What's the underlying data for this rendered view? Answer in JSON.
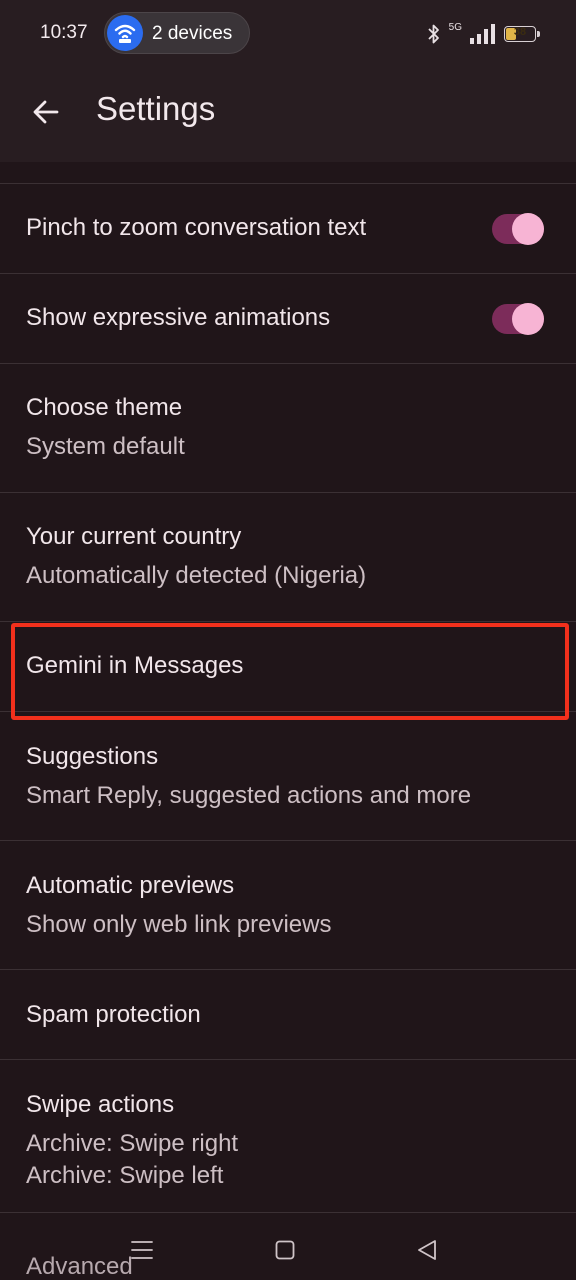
{
  "status_bar": {
    "time": "10:37",
    "hotspot_label": "2 devices",
    "network_type": "5G",
    "battery_level": "38",
    "battery_fraction": 0.38,
    "battery_color": "#e0b548"
  },
  "app_bar": {
    "title": "Settings",
    "back_icon": "arrow-left-icon"
  },
  "settings": {
    "pinch_zoom": {
      "title": "Pinch to zoom conversation text",
      "enabled": true
    },
    "expressive_animations": {
      "title": "Show expressive animations",
      "enabled": true
    },
    "choose_theme": {
      "title": "Choose theme",
      "value": "System default"
    },
    "current_country": {
      "title": "Your current country",
      "value": "Automatically detected (Nigeria)"
    },
    "gemini": {
      "title": "Gemini in Messages"
    },
    "suggestions": {
      "title": "Suggestions",
      "value": "Smart Reply, suggested actions and more"
    },
    "automatic_previews": {
      "title": "Automatic previews",
      "value": "Show only web link previews"
    },
    "spam_protection": {
      "title": "Spam protection"
    },
    "swipe_actions": {
      "title": "Swipe actions",
      "value_right": "Archive: Swipe right",
      "value_left": "Archive: Swipe left"
    },
    "advanced": {
      "title": "Advanced"
    }
  },
  "colors": {
    "background": "#201519",
    "toggle_track": "#7c2c5a",
    "toggle_knob": "#f7b4d4",
    "highlight": "#f2301c"
  },
  "nav_bar": {
    "recents_icon": "menu-lines-icon",
    "home_icon": "square-home-icon",
    "back_icon": "triangle-back-icon"
  }
}
